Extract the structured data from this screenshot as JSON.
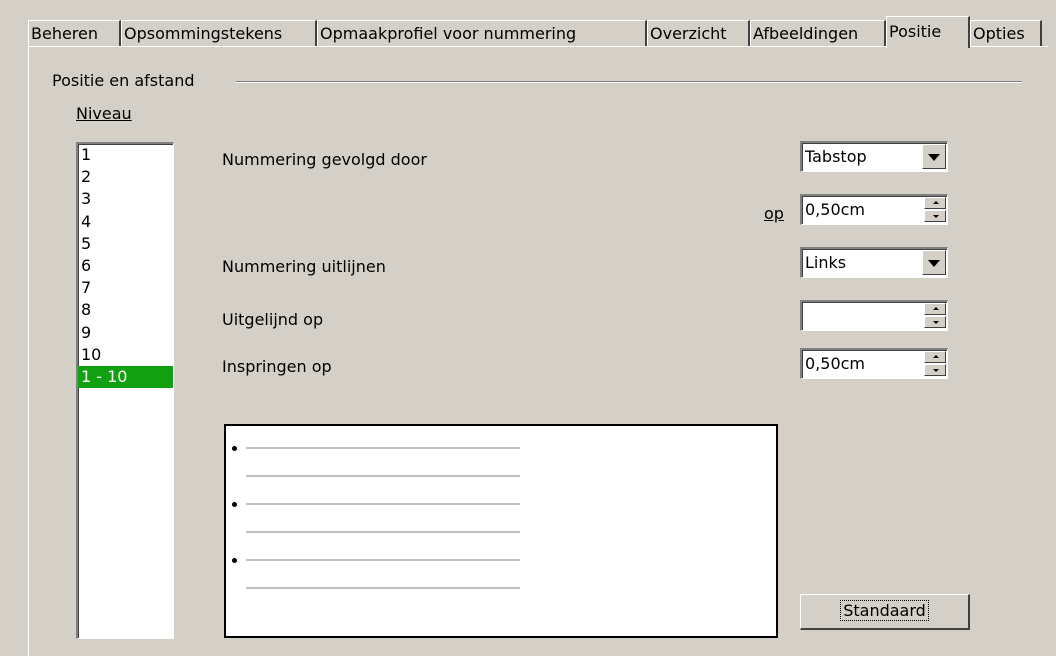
{
  "tabs": [
    "Beheren",
    "Opsommingstekens",
    "Opmaakprofiel voor nummering",
    "Overzicht",
    "Afbeeldingen",
    "Positie",
    "Opties"
  ],
  "active_tab": "Positie",
  "group": {
    "title": "Positie en afstand"
  },
  "level": {
    "label": "Niveau",
    "items": [
      "1",
      "2",
      "3",
      "4",
      "5",
      "6",
      "7",
      "8",
      "9",
      "10",
      "1 - 10"
    ],
    "selected": "1 - 10"
  },
  "fields": {
    "numbering_followed_by": {
      "label": "Nummering gevolgd door",
      "value": "Tabstop"
    },
    "at": {
      "label": "op",
      "value": "0,50cm"
    },
    "numbering_alignment": {
      "label": "Nummering uitlijnen",
      "value": "Links"
    },
    "aligned_at": {
      "label": "Uitgelijnd op",
      "value": ""
    },
    "indent_at": {
      "label": "Inspringen op",
      "value": "0,50cm"
    }
  },
  "buttons": {
    "default": "Standaard"
  },
  "colors": {
    "dialog_bg": "#d4d0c8",
    "selection": "#10a010"
  }
}
